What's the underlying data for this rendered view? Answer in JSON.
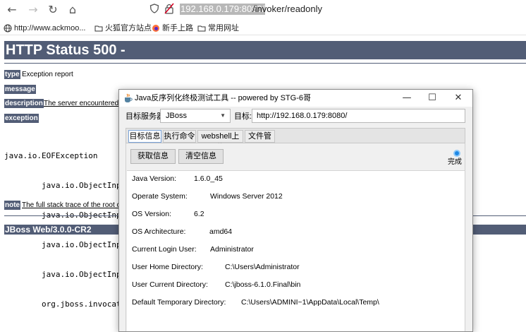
{
  "browser": {
    "url_host": "192.168.0.179:8080/",
    "url_path": "/invoker/readonly",
    "bookmarks": [
      {
        "label": "http://www.ackmoo...",
        "icon": "globe-icon"
      },
      {
        "label": "火狐官方站点",
        "icon": "folder-icon"
      },
      {
        "label": "新手上路",
        "icon": "firefox-icon"
      },
      {
        "label": "常用网址",
        "icon": "folder-icon"
      }
    ]
  },
  "error_page": {
    "title": "HTTP Status 500 -",
    "type_label": "type",
    "type_text": "Exception report",
    "message_label": "message",
    "description_label": "description",
    "description_text": "The server encountered a",
    "exception_label": "exception",
    "trace": [
      "java.io.EOFException",
      "        java.io.ObjectInpu",
      "        java.io.ObjectInpu",
      "        java.io.ObjectInpu",
      "        java.io.ObjectInpu",
      "        org.jboss.invocati"
    ],
    "note_label": "note",
    "note_text": "The full stack trace of the root ca",
    "footer": "JBoss Web/3.0.0-CR2"
  },
  "tool": {
    "title": "Java反序列化终极测试工具  -- powered by STG-6哥",
    "server_label": "目标服务器:",
    "server_value": "JBoss",
    "target_label": "目标:",
    "target_value": "http://192.168.0.179:8080/",
    "tabs": [
      "目标信息",
      "执行命令",
      "webshell上传",
      "文件管理"
    ],
    "get_info_button": "获取信息",
    "clear_info_button": "清空信息",
    "status": "完成",
    "info": [
      {
        "label": "Java Version:",
        "value": "1.6.0_45"
      },
      {
        "label": "Operate System:",
        "value": "Windows Server 2012"
      },
      {
        "label": "OS Version:",
        "value": "6.2"
      },
      {
        "label": "OS Architecture:",
        "value": "amd64"
      },
      {
        "label": "Current Login User:",
        "value": "Administrator"
      },
      {
        "label": "User Home Directory:",
        "value": "C:\\Users\\Administrator"
      },
      {
        "label": "User Current Directory:",
        "value": "C:\\jboss-6.1.0.Final\\bin"
      },
      {
        "label": "Default Temporary Directory:",
        "value": "C:\\Users\\ADMINI~1\\AppData\\Local\\Temp\\"
      }
    ]
  }
}
